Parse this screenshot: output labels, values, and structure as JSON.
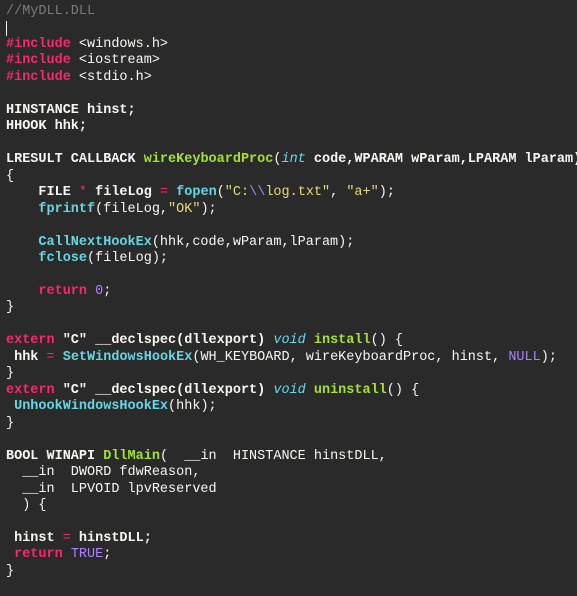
{
  "code": {
    "l1": "//MyDLL.DLL",
    "l3_include": "#include",
    "l3_hdr": " <windows.h>",
    "l4_include": "#include",
    "l4_hdr": " <iostream>",
    "l5_include": "#include",
    "l5_hdr": " <stdio.h>",
    "l7": "HINSTANCE hinst;",
    "l8": "HHOOK hhk;",
    "l10_ret": "LRESULT CALLBACK ",
    "l10_fn": "wireKeyboardProc",
    "l10_lp": "(",
    "l10_int": "int",
    "l10_rest": " code,WPARAM wParam,LPARAM lParam)",
    "l11": "{",
    "l12_pre": "    FILE ",
    "l12_op": "*",
    "l12_mid": " fileLog ",
    "l12_eq": "=",
    "l12_sp": " ",
    "l12_fn": "fopen",
    "l12_lp": "(",
    "l12_s1a": "\"C:",
    "l12_esc": "\\\\",
    "l12_s1b": "log.txt\"",
    "l12_comma": ", ",
    "l12_s2": "\"a+\"",
    "l12_end": ");",
    "l13_pre": "    ",
    "l13_fn": "fprintf",
    "l13_lp": "(fileLog,",
    "l13_str": "\"OK\"",
    "l13_end": ");",
    "l15_pre": "    ",
    "l15_fn": "CallNextHookEx",
    "l15_args": "(hhk,code,wParam,lParam);",
    "l16_pre": "    ",
    "l16_fn": "fclose",
    "l16_args": "(fileLog);",
    "l18_pre": "    ",
    "l18_kw": "return",
    "l18_sp": " ",
    "l18_num": "0",
    "l18_end": ";",
    "l19": "}",
    "l21_kw": "extern",
    "l21_mid": " \"C\" __declspec(dllexport) ",
    "l21_void": "void",
    "l21_sp": " ",
    "l21_fn": "install",
    "l21_end": "() {",
    "l22_pre": " hhk ",
    "l22_eq": "=",
    "l22_sp": " ",
    "l22_fn": "SetWindowsHookEx",
    "l22_args1": "(WH_KEYBOARD, wireKeyboardProc, hinst, ",
    "l22_null": "NULL",
    "l22_end": ");",
    "l23": "}",
    "l24_kw": "extern",
    "l24_mid": " \"C\" __declspec(dllexport) ",
    "l24_void": "void",
    "l24_sp": " ",
    "l24_fn": "uninstall",
    "l24_end": "() {",
    "l25_pre": " ",
    "l25_fn": "UnhookWindowsHookEx",
    "l25_args": "(hhk);",
    "l26": "}",
    "l28_pre": "BOOL WINAPI ",
    "l28_fn": "DllMain",
    "l28_rest": "(  __in  HINSTANCE hinstDLL,",
    "l29": "  __in  DWORD fdwReason,",
    "l30": "  __in  LPVOID lpvReserved",
    "l31": "  ) {",
    "l33_pre": " hinst ",
    "l33_eq": "=",
    "l33_end": " hinstDLL;",
    "l34_pre": " ",
    "l34_kw": "return",
    "l34_sp": " ",
    "l34_true": "TRUE",
    "l34_end": ";",
    "l35": "}"
  }
}
